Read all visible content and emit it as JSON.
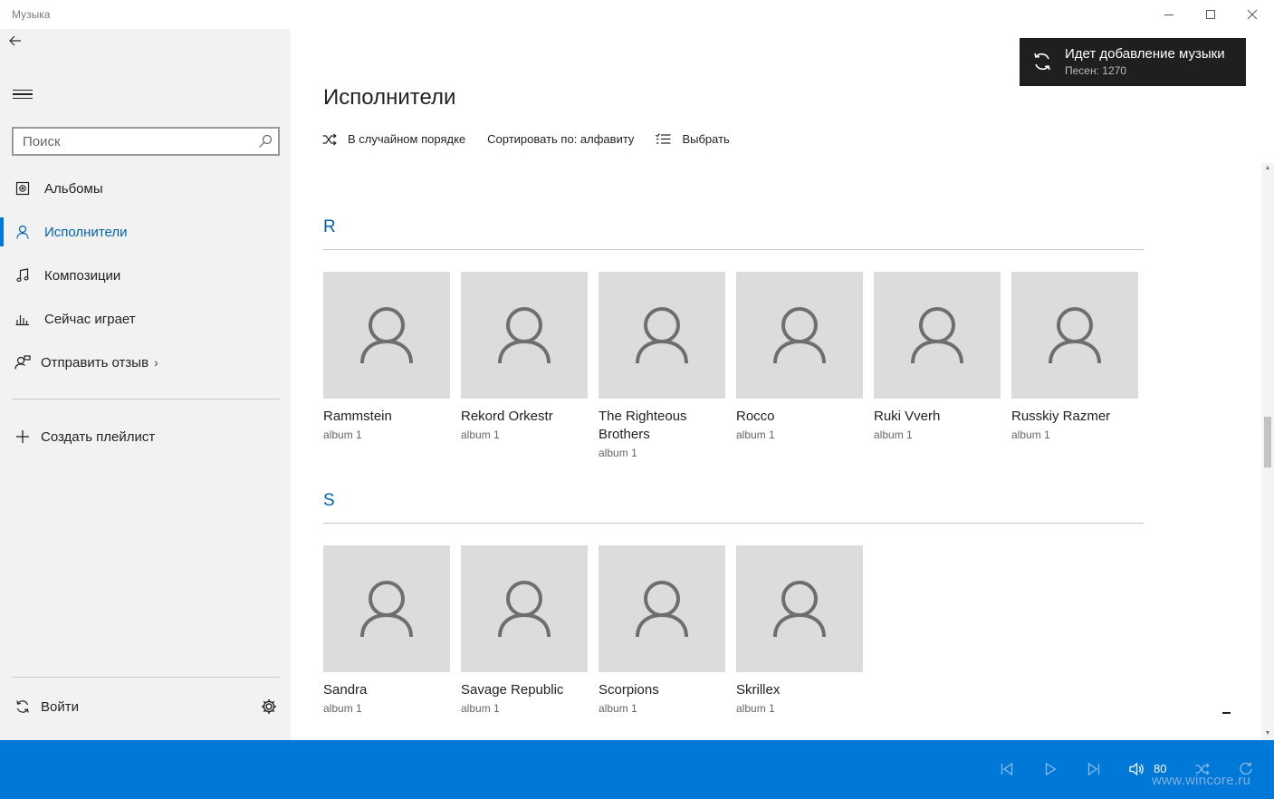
{
  "window": {
    "title": "Музыка"
  },
  "sidebar": {
    "search_placeholder": "Поиск",
    "items": [
      {
        "label": "Альбомы"
      },
      {
        "label": "Исполнители",
        "active": true
      },
      {
        "label": "Композиции"
      },
      {
        "label": "Сейчас играет"
      },
      {
        "label": "Отправить отзыв"
      },
      {
        "label": "Создать плейлист"
      }
    ],
    "signin_label": "Войти"
  },
  "main": {
    "title": "Исполнители",
    "commands": {
      "shuffle_label": "В случайном порядке",
      "sort_label": "Сортировать по: алфавиту",
      "select_label": "Выбрать"
    },
    "groups": [
      {
        "letter": "R",
        "artists": [
          {
            "name": "Rammstein",
            "sub": "album 1"
          },
          {
            "name": "Rekord Orkestr",
            "sub": "album 1"
          },
          {
            "name": "The Righteous Brothers",
            "sub": "album 1"
          },
          {
            "name": "Rocco",
            "sub": "album 1"
          },
          {
            "name": "Ruki Vverh",
            "sub": "album 1"
          },
          {
            "name": "Russkiy Razmer",
            "sub": "album 1"
          }
        ]
      },
      {
        "letter": "S",
        "artists": [
          {
            "name": "Sandra",
            "sub": "album 1"
          },
          {
            "name": "Savage Republic",
            "sub": "album 1"
          },
          {
            "name": "Scorpions",
            "sub": "album 1"
          },
          {
            "name": "Skrillex",
            "sub": "album 1"
          }
        ]
      }
    ]
  },
  "toast": {
    "title": "Идет добавление музыки",
    "subtitle": "Песен: 1270"
  },
  "player": {
    "volume": "80",
    "watermark": "www.wincore.ru"
  },
  "colors": {
    "accent": "#0078d7",
    "accent_text": "#0063b1",
    "sidebar_bg": "#f2f2f2",
    "tile_bg": "#dcdcdc",
    "toast_bg": "#1f1f1f"
  }
}
